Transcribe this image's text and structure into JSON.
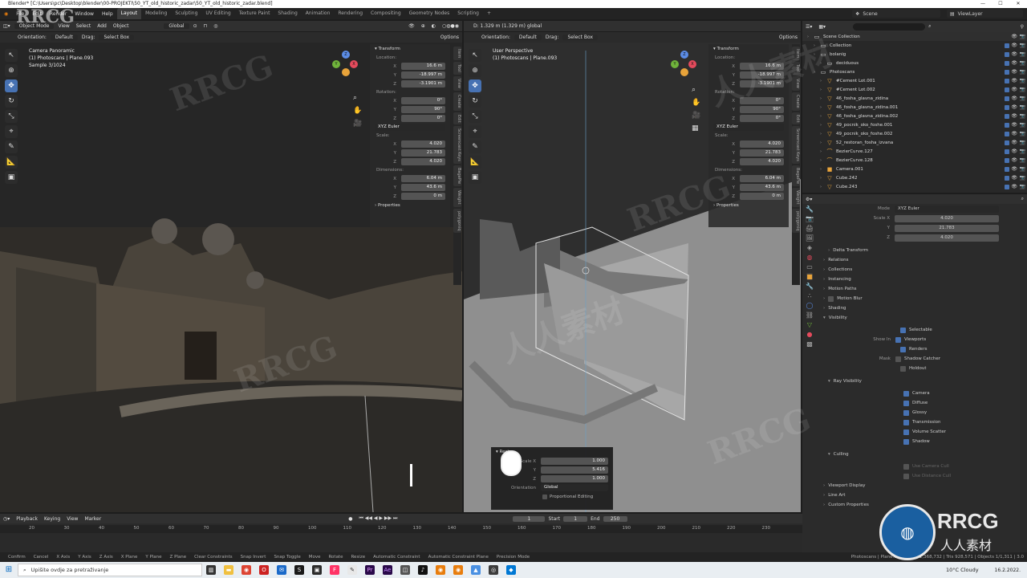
{
  "window": {
    "title": "Blender* [C:\\Users\\pc\\Desktop\\blender\\00-PROJEKTI\\50_YT_old_historic_zadar\\50_YT_old_historic_zadar.blend]",
    "controls": [
      "—",
      "☐",
      "✕"
    ]
  },
  "menu": [
    "File",
    "Edit",
    "Render",
    "Window",
    "Help"
  ],
  "workspaces": [
    "Layout",
    "Modeling",
    "Sculpting",
    "UV Editing",
    "Texture Paint",
    "Shading",
    "Animation",
    "Rendering",
    "Compositing",
    "Geometry Nodes",
    "Scripting",
    "+"
  ],
  "scene": "Scene",
  "view_layer": "ViewLayer",
  "left_viewport": {
    "header": {
      "mode": "Object Mode",
      "menus": [
        "View",
        "Select",
        "Add",
        "Object"
      ],
      "transform_orientation": "Global"
    },
    "subheader": {
      "orientation_label": "Orientation:",
      "orientation": "Default",
      "drag_label": "Drag:",
      "drag": "Select Box",
      "options": "Options"
    },
    "overlay": [
      "Camera Panoramic",
      "(1) Photoscans | Plane.093",
      "Sample 3/1024"
    ]
  },
  "right_viewport": {
    "header_info": "D: 1.329 m (1.329 m) global",
    "subheader": {
      "orientation_label": "Orientation:",
      "orientation": "Default",
      "drag_label": "Drag:",
      "drag": "Select Box",
      "options": "Options"
    },
    "overlay": [
      "User Perspective",
      "(1) Photoscans | Plane.093"
    ]
  },
  "npanel": {
    "title": "Transform",
    "location_label": "Location:",
    "location": [
      "16.6 m",
      "-18.997 m",
      "-3.1901 m"
    ],
    "rotation_label": "Rotation:",
    "rotation": [
      "0°",
      "90°",
      "0°"
    ],
    "rotation_mode": "XYZ Euler",
    "scale_label": "Scale:",
    "scale": [
      "4.020",
      "21.783",
      "4.020"
    ],
    "dimensions_label": "Dimensions:",
    "dimensions": [
      "6.04 m",
      "43.6 m",
      "0 m"
    ],
    "properties": "Properties",
    "axes": [
      "X",
      "Y",
      "Z"
    ],
    "tabs": [
      "Item",
      "Tool",
      "View",
      "Create",
      "Edit",
      "Screencast Keys",
      "BagaPie",
      "Weight",
      "polygoniq"
    ]
  },
  "redo_panel": {
    "title": "Resize",
    "scale_label": "Scale X",
    "scale": [
      "1.000",
      "5.416",
      "1.000"
    ],
    "axes": [
      "",
      "Y",
      "Z"
    ],
    "orientation_label": "Orientation",
    "orientation": "Global",
    "proportional": "Proportional Editing"
  },
  "outliner": {
    "search": "",
    "items": [
      {
        "name": "Scene Collection",
        "icon": "▭",
        "indent": 0
      },
      {
        "name": "Collection",
        "icon": "▭",
        "indent": 1
      },
      {
        "name": "bolanig",
        "icon": "▭",
        "indent": 1
      },
      {
        "name": "deciduous",
        "icon": "▭",
        "indent": 2
      },
      {
        "name": "Photoscans",
        "icon": "▭",
        "indent": 1
      },
      {
        "name": "#Cement Lot.001",
        "icon": "▽",
        "indent": 2
      },
      {
        "name": "#Cement Lot.002",
        "icon": "▽",
        "indent": 2
      },
      {
        "name": "46_fosha_glavna_zidina",
        "icon": "▽",
        "indent": 2
      },
      {
        "name": "46_fosha_glavna_zidina.001",
        "icon": "▽",
        "indent": 2
      },
      {
        "name": "46_fosha_glavna_zidina.002",
        "icon": "▽",
        "indent": 2
      },
      {
        "name": "49_pocnik_oko_foshe.001",
        "icon": "▽",
        "indent": 2
      },
      {
        "name": "49_pocnik_oko_foshe.002",
        "icon": "▽",
        "indent": 2
      },
      {
        "name": "52_restoran_fosha_izvana",
        "icon": "▽",
        "indent": 2
      },
      {
        "name": "BezierCurve.127",
        "icon": "⌒",
        "indent": 2
      },
      {
        "name": "BezierCurve.128",
        "icon": "⌒",
        "indent": 2
      },
      {
        "name": "Camera.001",
        "icon": "■",
        "indent": 2
      },
      {
        "name": "Cube.242",
        "icon": "▽",
        "indent": 2
      },
      {
        "name": "Cube.243",
        "icon": "▽",
        "indent": 2
      }
    ]
  },
  "properties": {
    "mode_label": "Mode",
    "mode": "XYZ Euler",
    "scale_label": [
      "Scale X",
      "Y",
      "Z"
    ],
    "scale": [
      "4.020",
      "21.783",
      "4.020"
    ],
    "sections": [
      "Delta Transform",
      "Relations",
      "Collections",
      "Instancing",
      "Motion Paths",
      "Motion Blur",
      "Shading",
      "Visibility"
    ],
    "visibility": {
      "selectable": "Selectable",
      "show_in": "Show In",
      "viewports": "Viewports",
      "renders": "Renders",
      "mask": "Mask",
      "shadow_catcher": "Shadow Catcher",
      "holdout": "Holdout"
    },
    "ray_visibility": {
      "title": "Ray Visibility",
      "items": [
        "Camera",
        "Diffuse",
        "Glossy",
        "Transmission",
        "Volume Scatter",
        "Shadow"
      ]
    },
    "culling": {
      "title": "Culling",
      "items": [
        "Use Camera Cull",
        "Use Distance Cull"
      ]
    },
    "more": [
      "Viewport Display",
      "Line Art",
      "Custom Properties"
    ],
    "stats": "Photoscans | Plane.093 | Verts 1,368,732 | Tris 928,571 | Objects 1/1,311 | 3.0"
  },
  "timeline": {
    "menus": [
      "Playback",
      "Keying",
      "View",
      "Marker"
    ],
    "current_frame": "1",
    "start_label": "Start",
    "start": "1",
    "end_label": "End",
    "end": "250",
    "ticks": [
      "20",
      "30",
      "40",
      "50",
      "60",
      "70",
      "80",
      "90",
      "100",
      "110",
      "120",
      "130",
      "140",
      "150",
      "160",
      "170",
      "180",
      "190",
      "200",
      "210",
      "220",
      "230"
    ]
  },
  "statusbar": [
    "Confirm",
    "Cancel",
    "X Axis",
    "Y Axis",
    "Z Axis",
    "X Plane",
    "Y Plane",
    "Z Plane",
    "Clear Constraints",
    "Snap Invert",
    "Snap Toggle",
    "Move",
    "Rotate",
    "Resize",
    "Automatic Constraint",
    "Automatic Constraint Plane",
    "Precision Mode"
  ],
  "taskbar": {
    "search": "Upišite ovdje za pretraživanje",
    "weather": "10°C Cloudy",
    "time": "16.2.2022."
  },
  "watermarks": [
    "RRCG",
    "人人素材"
  ],
  "logo": {
    "text": "RRCG",
    "sub": "人人素材"
  }
}
